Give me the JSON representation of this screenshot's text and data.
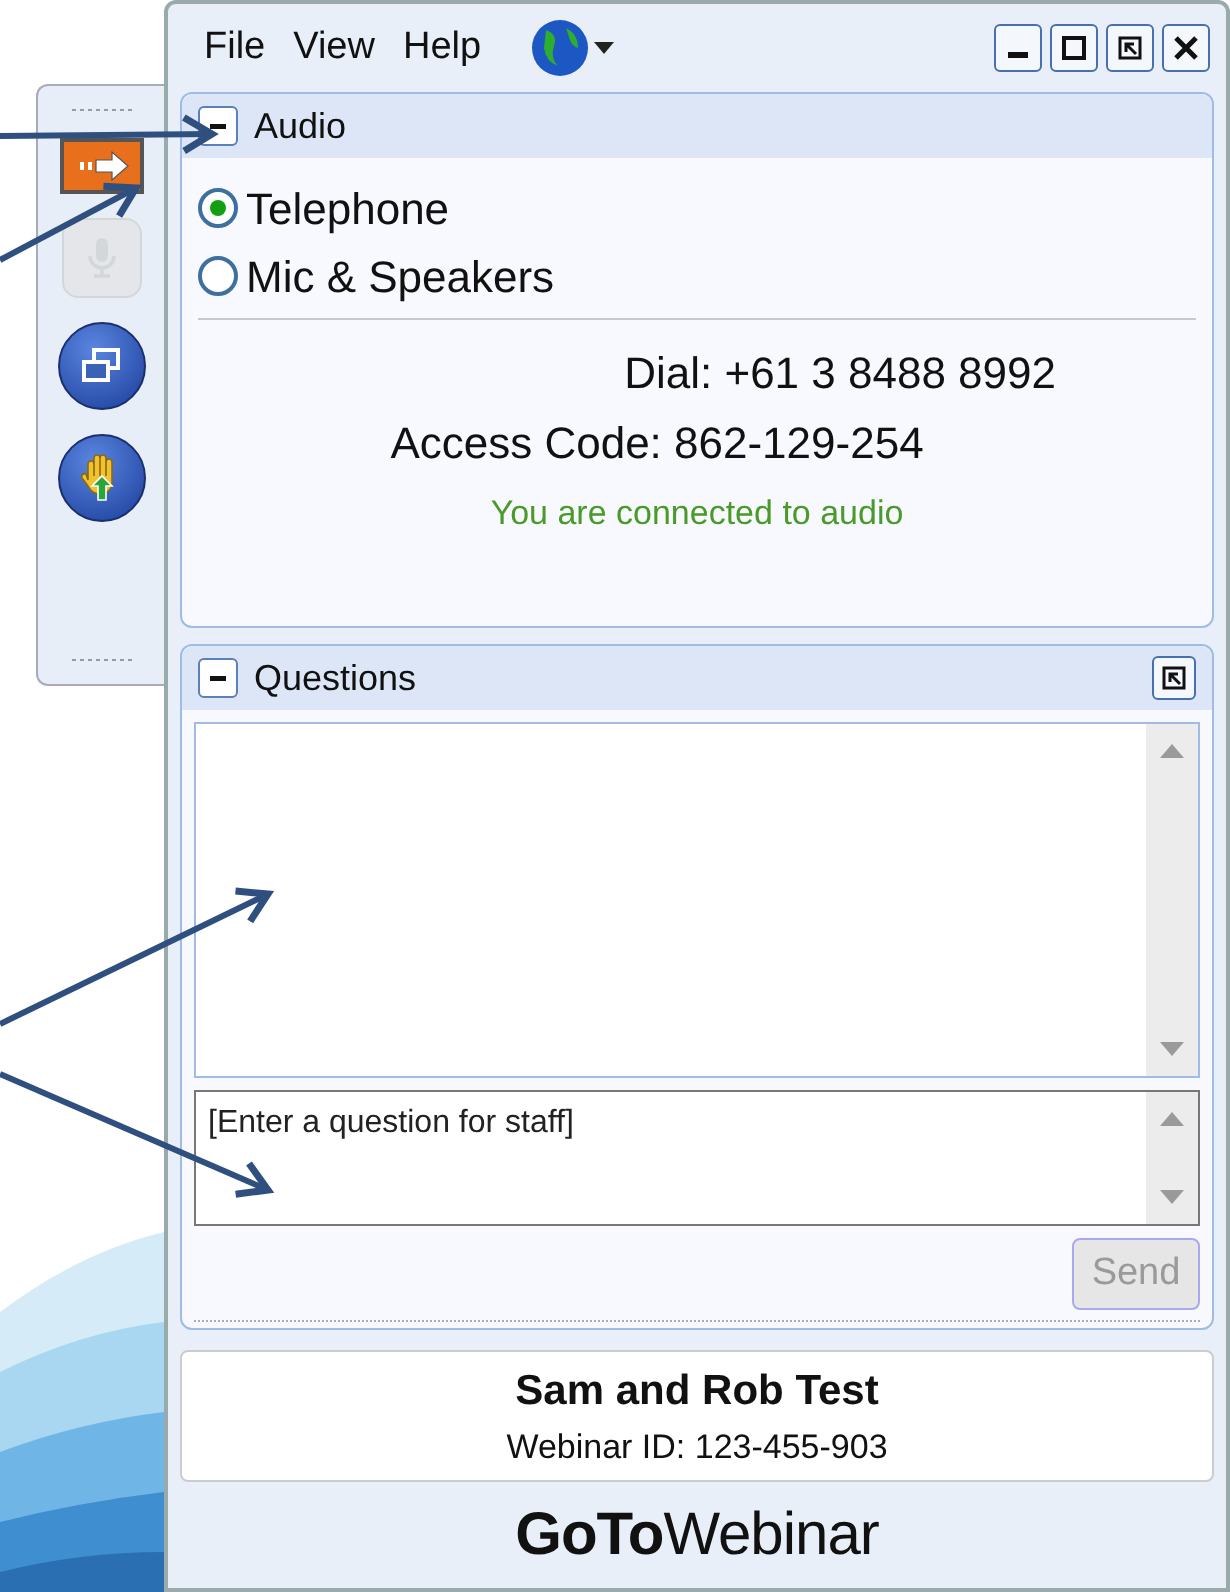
{
  "menu": [
    {
      "label": "File"
    },
    {
      "label": "View"
    },
    {
      "label": "Help"
    }
  ],
  "side_toolbar": [
    {
      "kind": "show-panel",
      "disabled": false
    },
    {
      "kind": "mic",
      "disabled": true
    },
    {
      "kind": "screen",
      "disabled": false
    },
    {
      "kind": "hand",
      "disabled": false
    }
  ],
  "audio": {
    "title": "Audio",
    "expanded": true,
    "options": [
      {
        "label": "Telephone",
        "selected": true
      },
      {
        "label": "Mic & Speakers",
        "selected": false
      }
    ],
    "dial": "Dial: +61 3 8488 8992",
    "access_code": "Access Code: 862-129-254",
    "status": "You are connected to audio"
  },
  "questions": {
    "title": "Questions",
    "expanded": true,
    "input": {
      "placeholder": "[Enter a question for staff]"
    },
    "send": {
      "label": "Send",
      "disabled": true
    }
  },
  "webinar": {
    "title": "Sam and Rob Test",
    "id": "Webinar ID: 123-455-903"
  },
  "logo": "**GoTo**Webinar"
}
